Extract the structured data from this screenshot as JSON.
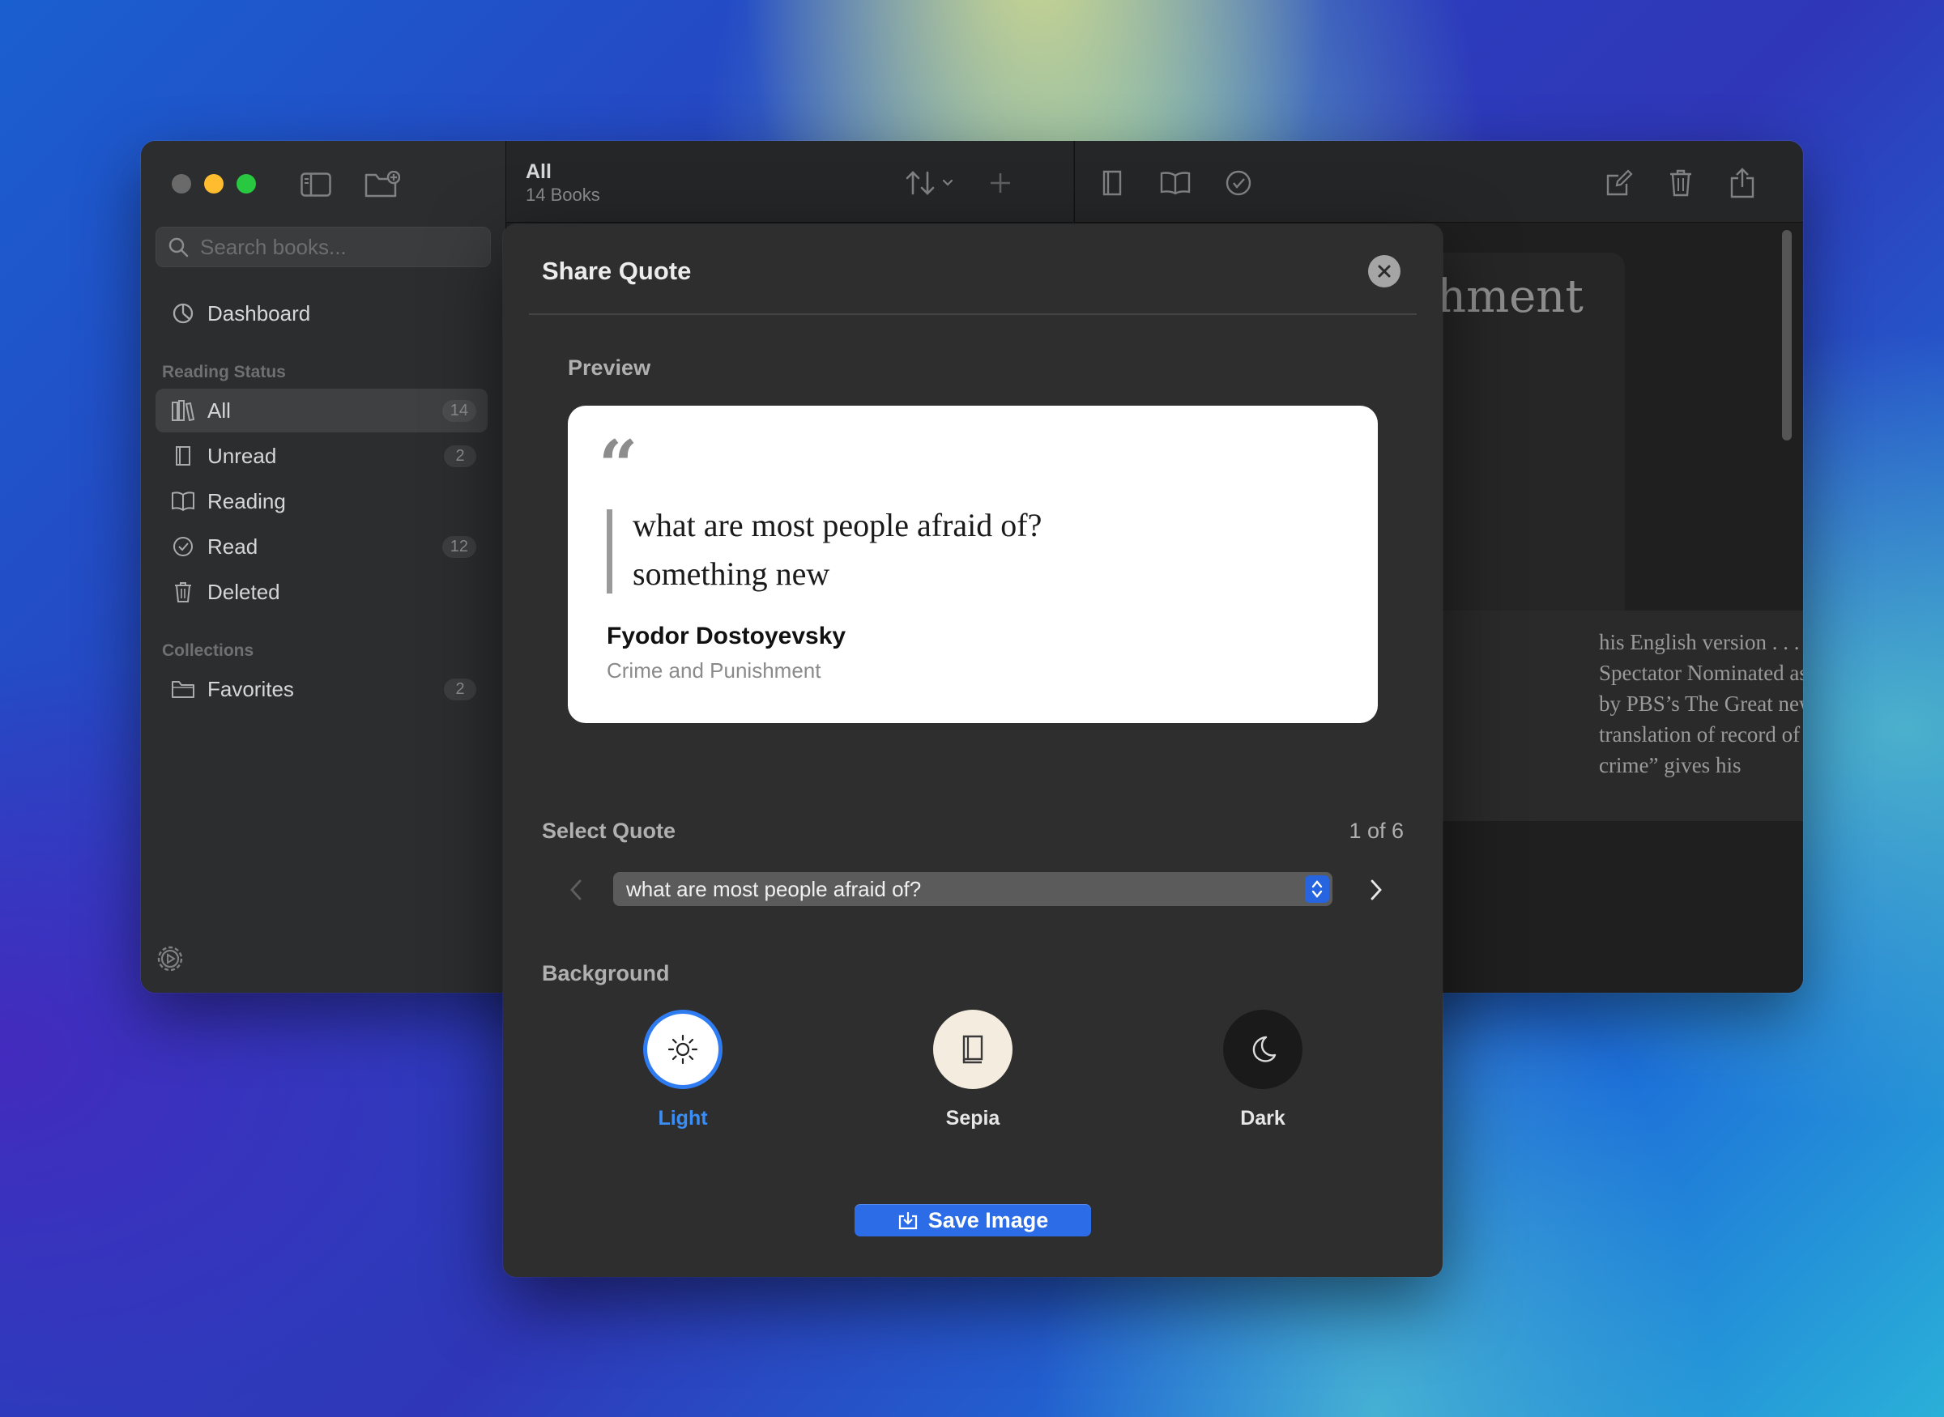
{
  "sidebar": {
    "search_placeholder": "Search books...",
    "dashboard_label": "Dashboard",
    "reading_status_label": "Reading Status",
    "status_items": [
      {
        "label": "All",
        "count": "14",
        "icon": "books-icon"
      },
      {
        "label": "Unread",
        "count": "2",
        "icon": "book-closed-icon"
      },
      {
        "label": "Reading",
        "count": "",
        "icon": "book-open-icon"
      },
      {
        "label": "Read",
        "count": "12",
        "icon": "checkmark-circle-icon"
      },
      {
        "label": "Deleted",
        "count": "",
        "icon": "trash-icon"
      }
    ],
    "collections_label": "Collections",
    "collections": [
      {
        "label": "Favorites",
        "count": "2",
        "icon": "folder-icon"
      }
    ]
  },
  "list_header": {
    "title": "All",
    "subtitle": "14 Books"
  },
  "detail": {
    "title_fragment": "hment",
    "description_fragment": "his English version . . . really Spectator Nominated as one by PBS’s The Great new translation of record of a crime” gives his"
  },
  "modal": {
    "title": "Share Quote",
    "preview_label": "Preview",
    "quote_mark": "“",
    "quote_text": "what are most people afraid of?\nsomething new",
    "author": "Fyodor Dostoyevsky",
    "book": "Crime and Punishment",
    "select_quote_label": "Select Quote",
    "quote_counter": "1 of 6",
    "selected_quote": "what are most people afraid of?",
    "background_label": "Background",
    "background_options": [
      {
        "label": "Light",
        "icon": "sun-icon",
        "selected": true
      },
      {
        "label": "Sepia",
        "icon": "book-icon",
        "selected": false
      },
      {
        "label": "Dark",
        "icon": "moon-icon",
        "selected": false
      }
    ],
    "save_label": "Save Image"
  },
  "colors": {
    "accent": "#2c6ce6",
    "selected_text": "#3a8ef6",
    "sepia": "#f4ecdf",
    "dark_swatch": "#1a1a1a"
  }
}
